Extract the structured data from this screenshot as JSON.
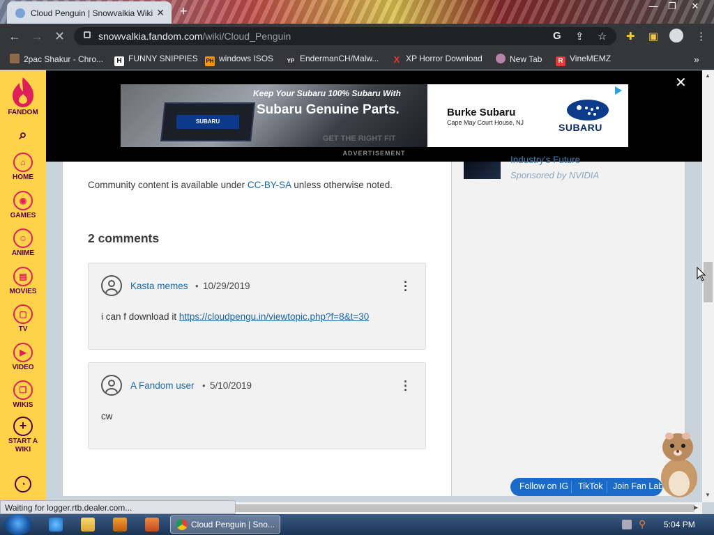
{
  "browser": {
    "tab_title": "Cloud Penguin | Snowvalkia Wiki",
    "url_host": "snowvalkia.fandom.com",
    "url_path": "/wiki/Cloud_Penguin",
    "status": "Waiting for logger.rtb.dealer.com..."
  },
  "bookmarks": [
    {
      "label": "2pac Shakur - Chro...",
      "icon": "tupac-icon"
    },
    {
      "label": "FUNNY SNIPPIES",
      "icon": "H"
    },
    {
      "label": "windows ISOS",
      "icon": "PH"
    },
    {
      "label": "EndermanCH/Malw...",
      "icon": "YP"
    },
    {
      "label": "XP Horror Download",
      "icon": "X"
    },
    {
      "label": "New Tab",
      "icon": "globe-icon"
    },
    {
      "label": "VineMEMZ",
      "icon": "R"
    }
  ],
  "fandom_nav": {
    "logo": "FANDOM",
    "items": [
      {
        "label": "HOME",
        "icon": "home-icon"
      },
      {
        "label": "GAMES",
        "icon": "gamepad-icon"
      },
      {
        "label": "ANIME",
        "icon": "anime-icon"
      },
      {
        "label": "MOVIES",
        "icon": "clapper-icon"
      },
      {
        "label": "TV",
        "icon": "tv-icon"
      },
      {
        "label": "VIDEO",
        "icon": "play-icon"
      },
      {
        "label": "WIKIS",
        "icon": "book-icon"
      },
      {
        "label": "START A WIKI",
        "icon": "plus-icon"
      }
    ]
  },
  "ad": {
    "line1": "Keep Your Subaru 100% Subaru With",
    "line2": "Subaru Genuine Parts.",
    "line3": "GET THE RIGHT FIT",
    "brand": "Burke Subaru",
    "location": "Cape May Court House, NJ",
    "logo_text": "SUBARU",
    "label": "ADVERTISEMENT"
  },
  "article": {
    "license_prefix": "Community content is available under",
    "license_link": "CC-BY-SA",
    "license_suffix": "unless otherwise noted.",
    "comments_heading": "2 comments"
  },
  "comments": [
    {
      "user": "Kasta memes",
      "date": "10/29/2019",
      "text": "i can f download it",
      "link": "https://cloudpengu.in/viewtopic.php?f=8&t=30"
    },
    {
      "user": "A Fandom user",
      "date": "5/10/2019",
      "text": "cw",
      "link": ""
    }
  ],
  "rail": {
    "sponsored_title": "Industry's Future",
    "sponsored_by": "Sponsored by NVIDIA"
  },
  "social": {
    "items": [
      "Follow on IG",
      "TikTok",
      "Join Fan Lab"
    ]
  },
  "taskbar": {
    "active_window": "Cloud Penguin | Sno...",
    "clock": "5:04 PM"
  }
}
